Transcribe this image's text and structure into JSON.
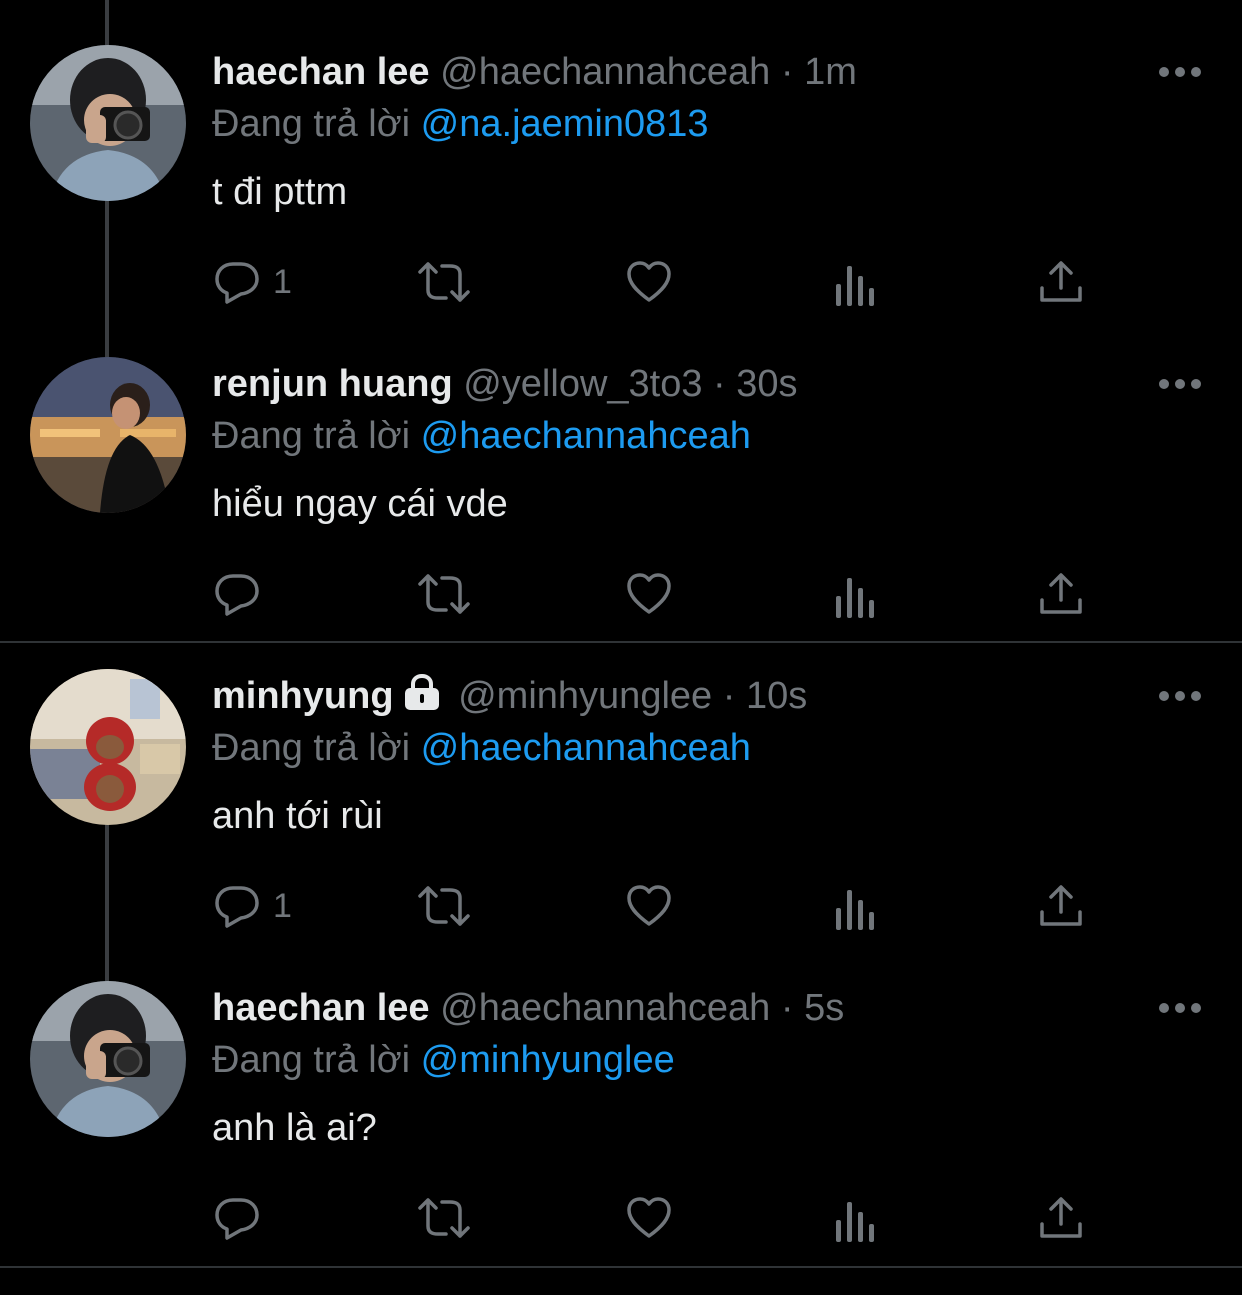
{
  "reply_prefix": "Đang trả lời",
  "colors": {
    "background": "#000000",
    "text": "#e7e9ea",
    "muted": "#71767b",
    "accent": "#1d9bf0",
    "divider": "#2f3336"
  },
  "action_icons": [
    "reply-icon",
    "retweet-icon",
    "like-icon",
    "views-icon",
    "share-icon"
  ],
  "tweets": [
    {
      "display_name": "haechan lee",
      "handle": "@haechannahceah",
      "time": "1m",
      "reply_to": "@na.jaemin0813",
      "text": "t đi pttm",
      "reply_count": "1",
      "protected": false
    },
    {
      "display_name": "renjun huang",
      "handle": "@yellow_3to3",
      "time": "30s",
      "reply_to": "@haechannahceah",
      "text": "hiểu ngay cái vde",
      "reply_count": "",
      "protected": false
    },
    {
      "display_name": "minhyung",
      "handle": "@minhyunglee",
      "time": "10s",
      "reply_to": "@haechannahceah",
      "text": "anh tới rùi",
      "reply_count": "1",
      "protected": true
    },
    {
      "display_name": "haechan lee",
      "handle": "@haechannahceah",
      "time": "5s",
      "reply_to": "@minhyunglee",
      "text": "anh là ai?",
      "reply_count": "",
      "protected": false
    }
  ],
  "separator": "·"
}
